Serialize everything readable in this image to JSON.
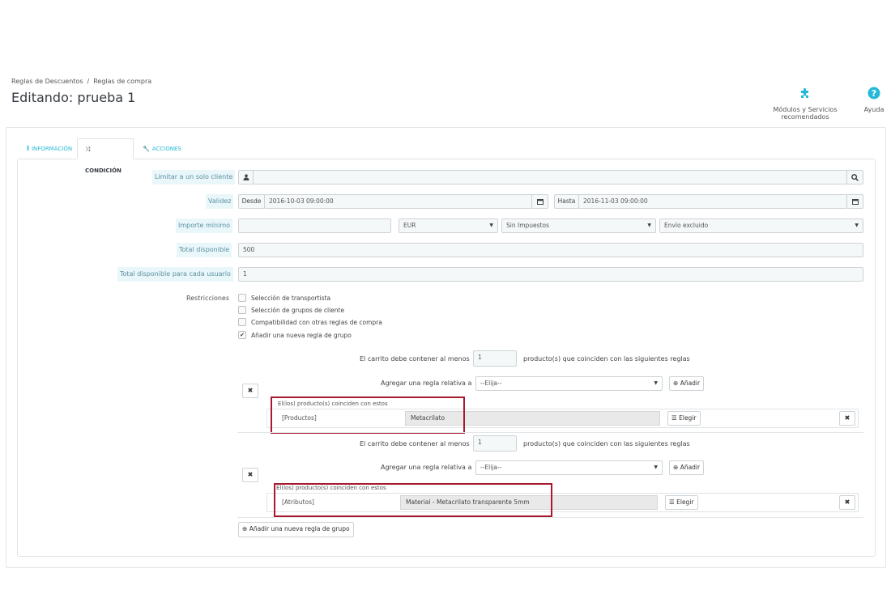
{
  "breadcrumb": {
    "parent": "Reglas de Descuentos",
    "separator": "/",
    "current": "Reglas de compra"
  },
  "page_title": "Editando: prueba 1",
  "toolbar": {
    "modules_label": "Módulos y Servicios recomendados",
    "help_label": "Ayuda",
    "modules_icon": "puzzle-icon",
    "help_icon": "question-circle-icon"
  },
  "tabs": [
    {
      "label": "Información",
      "icon": "info-icon",
      "icon_glyph": "i"
    },
    {
      "label": "Condición",
      "icon": "shuffle-icon",
      "icon_glyph": "⤨",
      "active": true
    },
    {
      "label": "Acciones",
      "icon": "wrench-icon",
      "icon_glyph": "🔧"
    }
  ],
  "form": {
    "limit_customer": {
      "label": "Limitar a un solo cliente",
      "value": ""
    },
    "validity": {
      "label": "Validez",
      "from_label": "Desde",
      "from_value": "2016-10-03 09:00:00",
      "to_label": "Hasta",
      "to_value": "2016-11-03 09:00:00"
    },
    "min_amount": {
      "label": "Importe mínimo",
      "value": "",
      "currency": "EUR",
      "tax": "Sin Impuestos",
      "shipping": "Envío excluido"
    },
    "total_available": {
      "label": "Total disponible",
      "value": "500"
    },
    "total_per_user": {
      "label": "Total disponible para cada usuario",
      "value": "1"
    },
    "restrictions": {
      "label": "Restricciones",
      "options": [
        {
          "label": "Selección de transportista",
          "checked": false
        },
        {
          "label": "Selección de grupos de cliente",
          "checked": false
        },
        {
          "label": "Compatibilidad con otras reglas de compra",
          "checked": false
        },
        {
          "label": "Añadir una nueva regla de grupo",
          "checked": true
        }
      ]
    },
    "rule_groups": [
      {
        "cart_prefix": "El carrito debe contener al menos",
        "quantity": "1",
        "cart_suffix": "producto(s) que coinciden con las siguientes reglas",
        "add_rule_label": "Agregar una regla relativa a",
        "add_rule_select": "--Elija--",
        "add_button": "Añadir",
        "rule_caption": "El(los) producto(s) coinciden con estos",
        "rule_type": "[Productos]",
        "rule_value": "Metacrilato",
        "choose_button": "Elegir"
      },
      {
        "cart_prefix": "El carrito debe contener al menos",
        "quantity": "1",
        "cart_suffix": "producto(s) que coinciden con las siguientes reglas",
        "add_rule_label": "Agregar una regla relativa a",
        "add_rule_select": "--Elija--",
        "add_button": "Añadir",
        "rule_caption": "El(los) producto(s) coinciden con estos",
        "rule_type": "[Atributos]",
        "rule_value": "Material - Metacrilato transparente 5mm",
        "choose_button": "Elegir"
      }
    ],
    "add_group_button": "Añadir una nueva regla de grupo"
  },
  "colors": {
    "accent": "#25b9d7",
    "highlight": "#a81930",
    "label_bg": "#eaf7fa"
  }
}
